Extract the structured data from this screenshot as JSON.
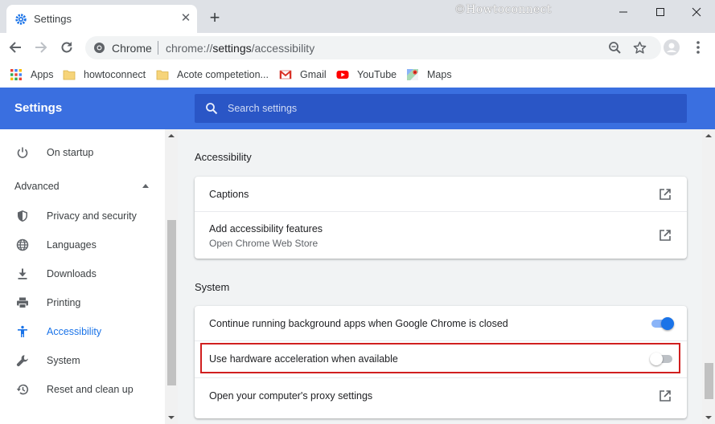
{
  "browser": {
    "tab": {
      "title": "Settings",
      "close_glyph": "✕",
      "favicon": "settings-gear-icon"
    },
    "new_tab_glyph": "+",
    "watermark": "©Howtoconnect",
    "omnibox": {
      "site": "Chrome",
      "url_prefix": "chrome://",
      "url_host": "settings",
      "url_path": "/accessibility"
    },
    "bookmarks": [
      {
        "label": "Apps",
        "icon": "apps-grid-icon"
      },
      {
        "label": "howtoconnect",
        "icon": "folder-icon"
      },
      {
        "label": "Acote competetion...",
        "icon": "folder-icon"
      },
      {
        "label": "Gmail",
        "icon": "gmail-icon"
      },
      {
        "label": "YouTube",
        "icon": "youtube-icon"
      },
      {
        "label": "Maps",
        "icon": "maps-icon"
      }
    ]
  },
  "settings": {
    "title": "Settings",
    "search_placeholder": "Search settings"
  },
  "sidebar": {
    "top_item": {
      "label": "On startup",
      "icon": "power-icon"
    },
    "advanced_label": "Advanced",
    "items": [
      {
        "label": "Privacy and security",
        "icon": "shield-icon"
      },
      {
        "label": "Languages",
        "icon": "globe-icon"
      },
      {
        "label": "Downloads",
        "icon": "download-icon"
      },
      {
        "label": "Printing",
        "icon": "printer-icon"
      },
      {
        "label": "Accessibility",
        "icon": "accessibility-icon",
        "active": true
      },
      {
        "label": "System",
        "icon": "wrench-icon"
      },
      {
        "label": "Reset and clean up",
        "icon": "restore-icon"
      }
    ]
  },
  "main": {
    "accessibility": {
      "title": "Accessibility",
      "rows": [
        {
          "label": "Captions"
        },
        {
          "label": "Add accessibility features",
          "sublabel": "Open Chrome Web Store"
        }
      ]
    },
    "system": {
      "title": "System",
      "rows": [
        {
          "label": "Continue running background apps when Google Chrome is closed",
          "toggle_on": true
        },
        {
          "label": "Use hardware acceleration when available",
          "toggle_on": false
        },
        {
          "label": "Open your computer's proxy settings"
        }
      ]
    }
  },
  "colors": {
    "header_blue": "#3a6fe0",
    "search_blue": "#2a56c6",
    "accent": "#1a73e8",
    "highlight_red": "#d01f1f"
  }
}
